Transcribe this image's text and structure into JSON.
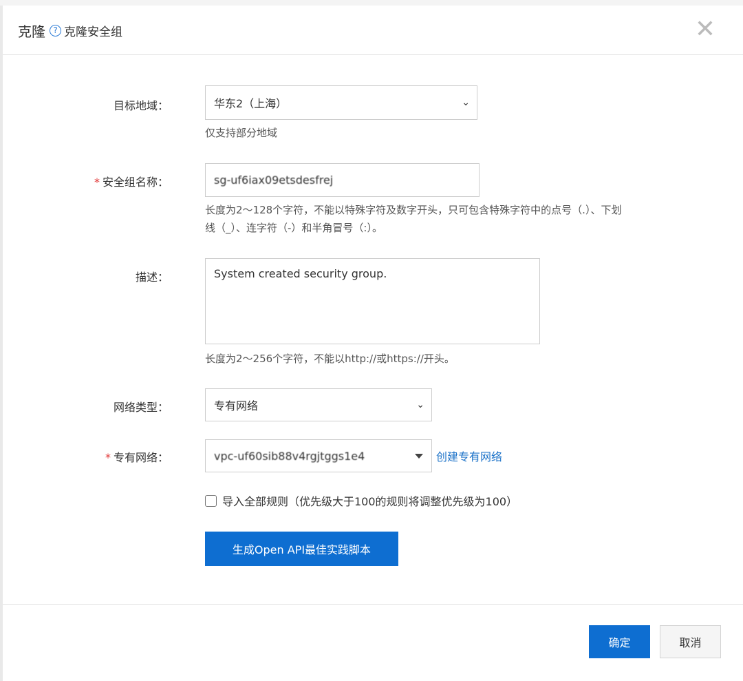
{
  "header": {
    "title": "克隆",
    "subtitle": "克隆安全组",
    "help_icon": "?",
    "close_icon": "✕"
  },
  "form": {
    "region": {
      "label": "目标地域：",
      "value": "华东2（上海）",
      "hint": "仅支持部分地域"
    },
    "name": {
      "label": "安全组名称：",
      "required": "*",
      "value": "sg-uf6iax09etsdesfrej",
      "hint_line1": "长度为2～128个字符，不能以特殊字符及数字开头，只可包含特殊字符中的点号（.）、下划",
      "hint_line2": "线（_）、连字符（-）和半角冒号（:）。"
    },
    "description": {
      "label": "描述：",
      "value": "System created security group.",
      "hint": "长度为2～256个字符，不能以http://或https://开头。"
    },
    "network_type": {
      "label": "网络类型：",
      "value": "专有网络"
    },
    "vpc": {
      "label": "专有网络：",
      "required": "*",
      "value": "vpc-uf60sib88v4rgjtggs1e4",
      "create_link": "创建专有网络"
    },
    "import_rules": {
      "label": "导入全部规则（优先级大于100的规则将调整优先级为100）",
      "checked": false
    },
    "generate_button": "生成Open API最佳实践脚本"
  },
  "footer": {
    "confirm": "确定",
    "cancel": "取消"
  }
}
